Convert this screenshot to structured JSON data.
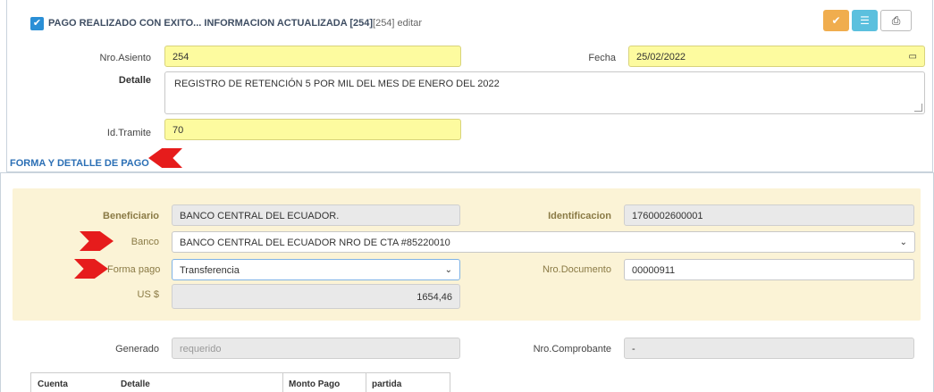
{
  "header": {
    "status_text": "PAGO REALIZADO CON EXITO... INFORMACION ACTUALIZADA [254]",
    "status_suffix": "[254] editar",
    "buttons": {
      "confirm_icon": "check-icon",
      "list_icon": "list-icon",
      "print_icon": "print-icon"
    }
  },
  "asiento": {
    "nro_label": "Nro.Asiento",
    "nro_value": "254",
    "fecha_label": "Fecha",
    "fecha_value": "25/02/2022",
    "detalle_label": "Detalle",
    "detalle_value": "REGISTRO DE RETENCIÓN 5 POR MIL DEL MES DE ENERO DEL 2022",
    "tramite_label": "Id.Tramite",
    "tramite_value": "70"
  },
  "section_title": "FORMA Y DETALLE DE PAGO",
  "pago": {
    "beneficiario_label": "Beneficiario",
    "beneficiario_value": "BANCO CENTRAL DEL ECUADOR.",
    "identificacion_label": "Identificacion",
    "identificacion_value": "1760002600001",
    "banco_label": "Banco",
    "banco_value": "BANCO CENTRAL DEL ECUADOR NRO DE CTA #85220010",
    "forma_label": "Forma pago",
    "forma_value": "Transferencia",
    "documento_label": "Nro.Documento",
    "documento_value": "00000911",
    "monto_label": "US $",
    "monto_value": "1654,46"
  },
  "generado": {
    "generado_label": "Generado",
    "generado_placeholder": "requerido",
    "comprobante_label": "Nro.Comprobante",
    "comprobante_value": "-"
  },
  "table": {
    "columns": [
      "Cuenta",
      "Detalle",
      "Monto Pago",
      "partida"
    ]
  },
  "colors": {
    "accent": "#2a8fd6",
    "highlight": "#fdfb9f",
    "section_bg": "#fbf3d6",
    "marker": "#e61c1c"
  }
}
